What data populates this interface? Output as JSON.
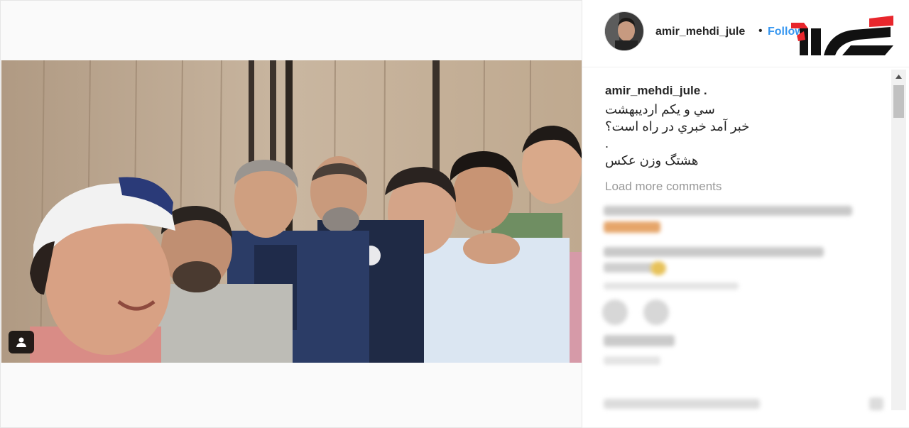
{
  "post": {
    "username": "amir_mehdi_jule",
    "separator": "•",
    "follow_label": "Follow",
    "caption": {
      "username": "amir_mehdi_jule .",
      "lines": [
        "سي و يكم ارديبهشت",
        "خبر آمد خبري در راه است؟",
        ".",
        "هشتگ وزن عكس"
      ]
    },
    "load_more_label": "Load more comments"
  },
  "colors": {
    "follow": "#3897f0",
    "logo_red": "#e8262c",
    "logo_black": "#111111",
    "muted": "#999999"
  },
  "icons": {
    "tag_people": "person-silhouette-icon",
    "scroll_up": "triangle-up-icon"
  }
}
